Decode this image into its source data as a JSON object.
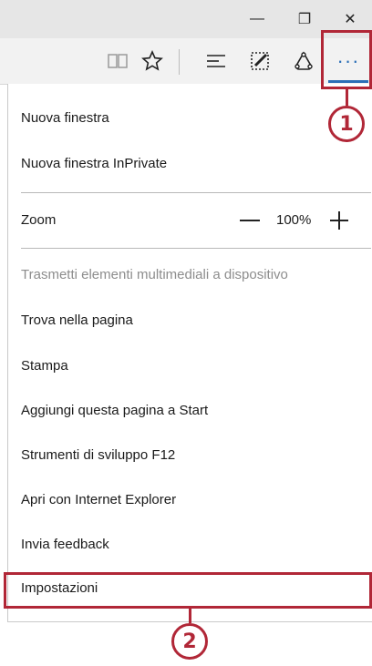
{
  "window": {
    "minimize_glyph": "—",
    "restore_glyph": "❐",
    "close_glyph": "✕"
  },
  "toolbar": {
    "icons": [
      "reading-view-icon",
      "favorites-star-icon",
      "hub-icon",
      "web-note-icon",
      "share-icon",
      "more-actions-icon"
    ],
    "more_glyph": "···",
    "accent_color": "#2b6fb7"
  },
  "menu": {
    "new_window": "Nuova finestra",
    "new_inprivate": "Nuova finestra InPrivate",
    "zoom_label": "Zoom",
    "zoom_value": "100%",
    "cast": "Trasmetti elementi multimediali a dispositivo",
    "find": "Trova nella pagina",
    "print": "Stampa",
    "pin_start": "Aggiungi questa pagina a Start",
    "devtools": "Strumenti di sviluppo F12",
    "open_ie": "Apri con Internet Explorer",
    "feedback": "Invia feedback",
    "settings": "Impostazioni"
  },
  "callouts": {
    "color": "#b12737",
    "step1": "1",
    "step2": "2"
  }
}
